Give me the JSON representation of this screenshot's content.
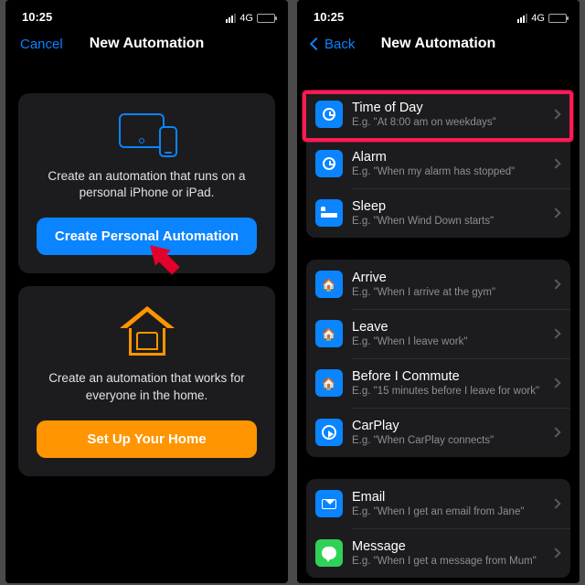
{
  "status": {
    "time": "10:25",
    "net": "4G"
  },
  "left": {
    "nav": {
      "cancel": "Cancel",
      "title": "New Automation"
    },
    "personal": {
      "desc": "Create an automation that runs on a personal iPhone or iPad.",
      "button": "Create Personal Automation"
    },
    "home": {
      "desc": "Create an automation that works for everyone in the home.",
      "button": "Set Up Your Home"
    }
  },
  "right": {
    "nav": {
      "back": "Back",
      "title": "New Automation"
    },
    "groups": [
      {
        "rows": [
          {
            "icon": "clock",
            "title": "Time of Day",
            "sub": "E.g. \"At 8:00 am on weekdays\"",
            "highlight": true
          },
          {
            "icon": "alarm",
            "title": "Alarm",
            "sub": "E.g. \"When my alarm has stopped\""
          },
          {
            "icon": "bed",
            "title": "Sleep",
            "sub": "E.g. \"When Wind Down starts\""
          }
        ]
      },
      {
        "rows": [
          {
            "icon": "arrive",
            "title": "Arrive",
            "sub": "E.g. \"When I arrive at the gym\""
          },
          {
            "icon": "leave",
            "title": "Leave",
            "sub": "E.g. \"When I leave work\""
          },
          {
            "icon": "commute",
            "title": "Before I Commute",
            "sub": "E.g. \"15 minutes before I leave for work\""
          },
          {
            "icon": "carplay",
            "title": "CarPlay",
            "sub": "E.g. \"When CarPlay connects\""
          }
        ]
      },
      {
        "rows": [
          {
            "icon": "mail",
            "title": "Email",
            "sub": "E.g. \"When I get an email from Jane\""
          },
          {
            "icon": "message",
            "title": "Message",
            "sub": "E.g. \"When I get a message from Mum\""
          }
        ]
      }
    ]
  }
}
